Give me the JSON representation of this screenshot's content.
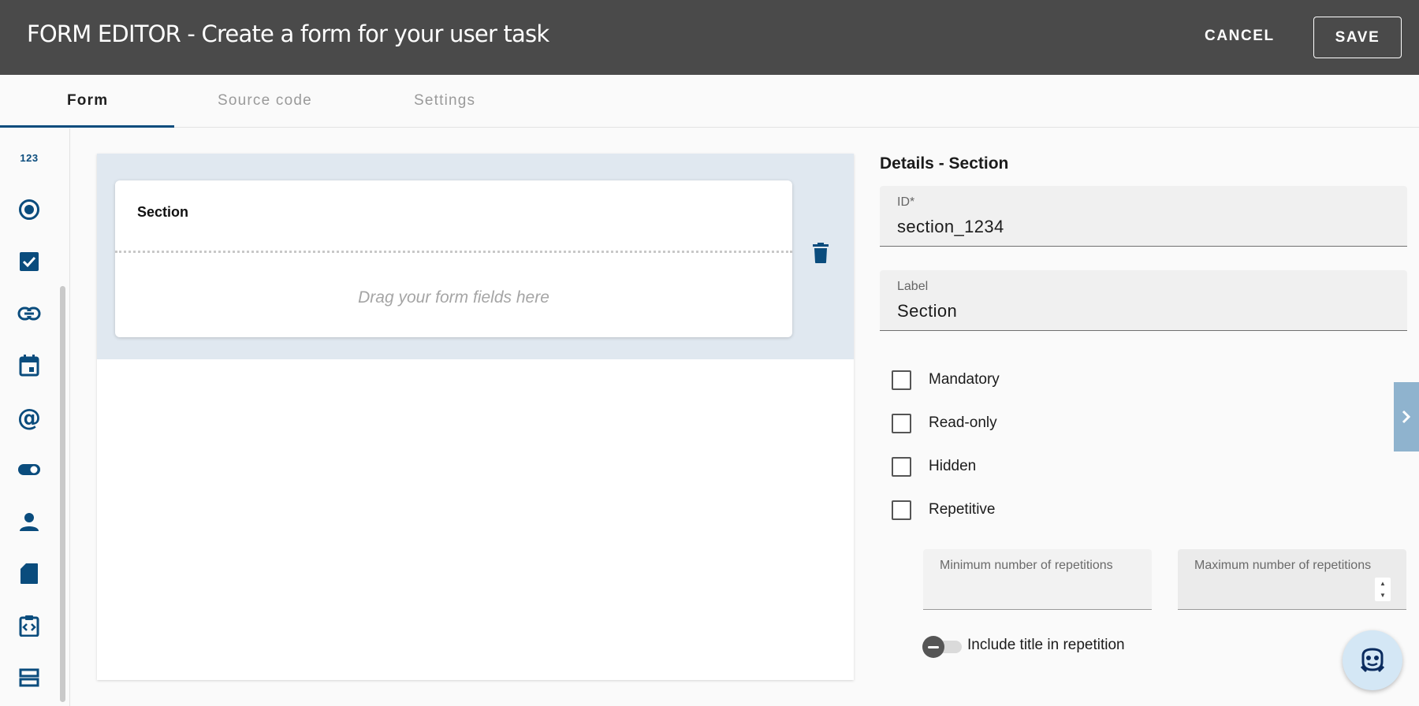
{
  "header": {
    "title": "FORM EDITOR - Create a form for your user task",
    "cancel_label": "CANCEL",
    "save_label": "SAVE"
  },
  "tabs": [
    {
      "label": "Form",
      "active": true
    },
    {
      "label": "Source code",
      "active": false
    },
    {
      "label": "Settings",
      "active": false
    }
  ],
  "sidebar": {
    "icons": [
      "number-icon",
      "radio-icon",
      "checkbox-icon",
      "link-icon",
      "calendar-icon",
      "at-icon",
      "toggle-icon",
      "person-icon",
      "file-icon",
      "code-clipboard-icon",
      "section-icon"
    ],
    "number_glyph": "123"
  },
  "canvas": {
    "section_title": "Section",
    "drag_hint": "Drag your form fields here"
  },
  "details": {
    "title": "Details - Section",
    "id_label": "ID*",
    "id_value": "section_1234",
    "label_label": "Label",
    "label_value": "Section",
    "checkboxes": [
      {
        "label": "Mandatory",
        "checked": false
      },
      {
        "label": "Read-only",
        "checked": false
      },
      {
        "label": "Hidden",
        "checked": false
      },
      {
        "label": "Repetitive",
        "checked": false
      }
    ],
    "min_repetitions_label": "Minimum number of repetitions",
    "max_repetitions_label": "Maximum number of repetitions",
    "include_title_label": "Include title in repetition",
    "include_title_on": false
  },
  "colors": {
    "header_bg": "#4a4a4a",
    "accent": "#0a4c7d",
    "section_zone_bg": "#e0e8f0",
    "side_tab": "#8fb3ce"
  }
}
